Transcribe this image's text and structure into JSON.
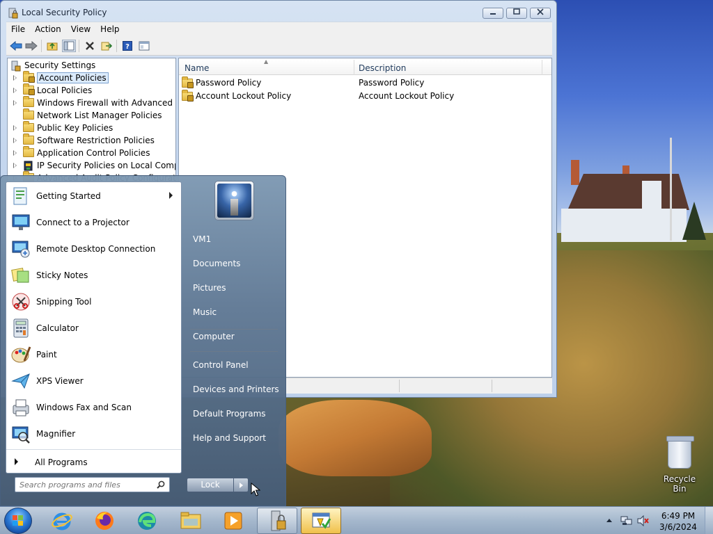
{
  "desktop": {
    "icons": [
      {
        "label": "Recycle Bin",
        "icon": "recycle-bin-icon"
      }
    ]
  },
  "window": {
    "title": "Local Security Policy",
    "menu": [
      "File",
      "Action",
      "View",
      "Help"
    ],
    "toolbar_icons": [
      "back-icon",
      "forward-icon",
      "up-folder-icon",
      "show-hide-tree-icon",
      "delete-icon",
      "export-list-icon",
      "help-icon",
      "properties-icon"
    ],
    "tree": [
      {
        "label": "Security Settings",
        "icon": "security-settings-icon",
        "expander": false,
        "level": 0
      },
      {
        "label": "Account Policies",
        "icon": "lock-folder-icon",
        "expander": true,
        "level": 1,
        "selected": true
      },
      {
        "label": "Local Policies",
        "icon": "lock-folder-icon",
        "expander": true,
        "level": 1
      },
      {
        "label": "Windows Firewall with Advanced Security",
        "icon": "folder-icon",
        "expander": true,
        "level": 1
      },
      {
        "label": "Network List Manager Policies",
        "icon": "folder-icon",
        "expander": false,
        "level": 1
      },
      {
        "label": "Public Key Policies",
        "icon": "folder-icon",
        "expander": true,
        "level": 1
      },
      {
        "label": "Software Restriction Policies",
        "icon": "folder-icon",
        "expander": true,
        "level": 1
      },
      {
        "label": "Application Control Policies",
        "icon": "folder-icon",
        "expander": true,
        "level": 1
      },
      {
        "label": "IP Security Policies on Local Computer",
        "icon": "ip-security-icon",
        "expander": true,
        "level": 1
      },
      {
        "label": "Advanced Audit Policy Configuration",
        "icon": "folder-icon",
        "expander": true,
        "level": 1
      }
    ],
    "list": {
      "columns": [
        "Name",
        "Description"
      ],
      "rows": [
        {
          "name": "Password Policy",
          "description": "Password Policy",
          "icon": "lock-folder-icon"
        },
        {
          "name": "Account Lockout Policy",
          "description": "Account Lockout Policy",
          "icon": "lock-folder-icon"
        }
      ]
    }
  },
  "start_menu": {
    "programs": [
      {
        "label": "Getting Started",
        "icon": "getting-started-icon",
        "submenu": true
      },
      {
        "label": "Connect to a Projector",
        "icon": "projector-icon",
        "submenu": false
      },
      {
        "label": "Remote Desktop Connection",
        "icon": "remote-desktop-icon",
        "submenu": false
      },
      {
        "label": "Sticky Notes",
        "icon": "sticky-notes-icon",
        "submenu": false
      },
      {
        "label": "Snipping Tool",
        "icon": "snipping-tool-icon",
        "submenu": false
      },
      {
        "label": "Calculator",
        "icon": "calculator-icon",
        "submenu": false
      },
      {
        "label": "Paint",
        "icon": "paint-icon",
        "submenu": false
      },
      {
        "label": "XPS Viewer",
        "icon": "xps-viewer-icon",
        "submenu": false
      },
      {
        "label": "Windows Fax and Scan",
        "icon": "fax-scan-icon",
        "submenu": false
      },
      {
        "label": "Magnifier",
        "icon": "magnifier-icon",
        "submenu": false
      }
    ],
    "all_programs": "All Programs",
    "search_placeholder": "Search programs and files",
    "right": {
      "user": "VM1",
      "links": [
        "Documents",
        "Pictures",
        "Music",
        "Computer",
        "Control Panel",
        "Devices and Printers",
        "Default Programs",
        "Help and Support"
      ]
    },
    "power_button": "Lock"
  },
  "taskbar": {
    "items": [
      "internet-explorer-icon",
      "firefox-icon",
      "edge-icon",
      "file-explorer-icon",
      "media-player-icon",
      "local-security-policy-icon",
      "security-policy-window-icon"
    ],
    "time": "6:49 PM",
    "date": "3/6/2024",
    "tray_icons": [
      "show-hidden-icons-icon",
      "network-icon",
      "volume-muted-icon"
    ]
  }
}
